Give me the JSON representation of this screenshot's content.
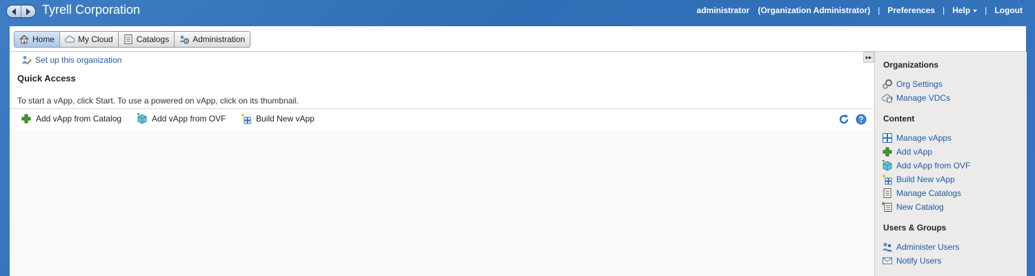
{
  "header": {
    "org_title": "Tyrell Corporation",
    "user": "administrator",
    "role": "(Organization Administrator)",
    "preferences": "Preferences",
    "help": "Help",
    "logout": "Logout",
    "separator": "|"
  },
  "tabs": [
    {
      "label": "Home",
      "icon": "home-icon",
      "active": true
    },
    {
      "label": "My Cloud",
      "icon": "cloud-icon"
    },
    {
      "label": "Catalogs",
      "icon": "catalog-icon"
    },
    {
      "label": "Administration",
      "icon": "admin-icon"
    }
  ],
  "main": {
    "setup_link": "Set up this organization",
    "quick_access_title": "Quick Access",
    "description": "To start a vApp, click Start. To use a powered on vApp, click on its thumbnail.",
    "collapse_glyph": "▸▸",
    "toolbar": {
      "add_from_catalog": "Add vApp from Catalog",
      "add_from_ovf": "Add vApp from OVF",
      "build_new": "Build New vApp"
    }
  },
  "sidebar": {
    "organizations_title": "Organizations",
    "org_settings": "Org Settings",
    "manage_vdcs": "Manage VDCs",
    "content_title": "Content",
    "manage_vapps": "Manage vApps",
    "add_vapp": "Add vApp",
    "add_vapp_ovf": "Add vApp from OVF",
    "build_new_vapp": "Build New vApp",
    "manage_catalogs": "Manage Catalogs",
    "new_catalog": "New Catalog",
    "users_title": "Users & Groups",
    "administer_users": "Administer Users",
    "notify_users": "Notify Users"
  },
  "colors": {
    "header_blue": "#2f6db5",
    "link_blue": "#1d5aa8",
    "sidebar_bg": "#ecebea"
  }
}
